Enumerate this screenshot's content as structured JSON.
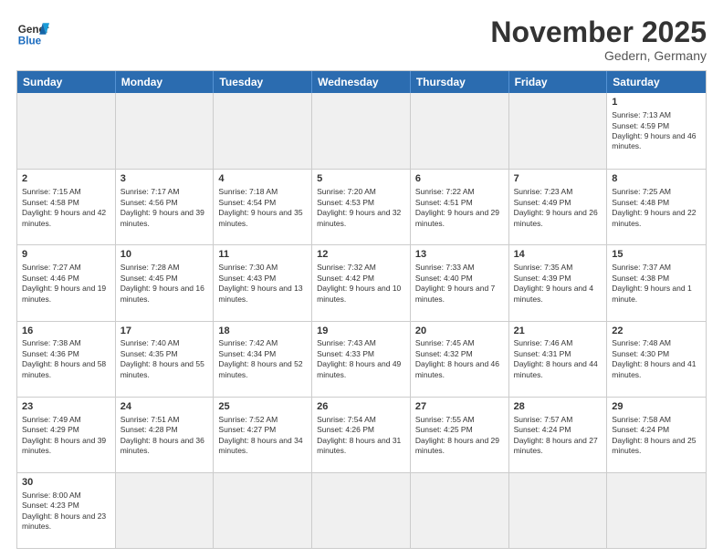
{
  "header": {
    "logo_general": "General",
    "logo_blue": "Blue",
    "month_title": "November 2025",
    "location": "Gedern, Germany"
  },
  "days": [
    "Sunday",
    "Monday",
    "Tuesday",
    "Wednesday",
    "Thursday",
    "Friday",
    "Saturday"
  ],
  "weeks": [
    [
      {
        "num": "",
        "text": "",
        "empty": true
      },
      {
        "num": "",
        "text": "",
        "empty": true
      },
      {
        "num": "",
        "text": "",
        "empty": true
      },
      {
        "num": "",
        "text": "",
        "empty": true
      },
      {
        "num": "",
        "text": "",
        "empty": true
      },
      {
        "num": "",
        "text": "",
        "empty": true
      },
      {
        "num": "1",
        "text": "Sunrise: 7:13 AM\nSunset: 4:59 PM\nDaylight: 9 hours and 46 minutes."
      }
    ],
    [
      {
        "num": "2",
        "text": "Sunrise: 7:15 AM\nSunset: 4:58 PM\nDaylight: 9 hours and 42 minutes."
      },
      {
        "num": "3",
        "text": "Sunrise: 7:17 AM\nSunset: 4:56 PM\nDaylight: 9 hours and 39 minutes."
      },
      {
        "num": "4",
        "text": "Sunrise: 7:18 AM\nSunset: 4:54 PM\nDaylight: 9 hours and 35 minutes."
      },
      {
        "num": "5",
        "text": "Sunrise: 7:20 AM\nSunset: 4:53 PM\nDaylight: 9 hours and 32 minutes."
      },
      {
        "num": "6",
        "text": "Sunrise: 7:22 AM\nSunset: 4:51 PM\nDaylight: 9 hours and 29 minutes."
      },
      {
        "num": "7",
        "text": "Sunrise: 7:23 AM\nSunset: 4:49 PM\nDaylight: 9 hours and 26 minutes."
      },
      {
        "num": "8",
        "text": "Sunrise: 7:25 AM\nSunset: 4:48 PM\nDaylight: 9 hours and 22 minutes."
      }
    ],
    [
      {
        "num": "9",
        "text": "Sunrise: 7:27 AM\nSunset: 4:46 PM\nDaylight: 9 hours and 19 minutes."
      },
      {
        "num": "10",
        "text": "Sunrise: 7:28 AM\nSunset: 4:45 PM\nDaylight: 9 hours and 16 minutes."
      },
      {
        "num": "11",
        "text": "Sunrise: 7:30 AM\nSunset: 4:43 PM\nDaylight: 9 hours and 13 minutes."
      },
      {
        "num": "12",
        "text": "Sunrise: 7:32 AM\nSunset: 4:42 PM\nDaylight: 9 hours and 10 minutes."
      },
      {
        "num": "13",
        "text": "Sunrise: 7:33 AM\nSunset: 4:40 PM\nDaylight: 9 hours and 7 minutes."
      },
      {
        "num": "14",
        "text": "Sunrise: 7:35 AM\nSunset: 4:39 PM\nDaylight: 9 hours and 4 minutes."
      },
      {
        "num": "15",
        "text": "Sunrise: 7:37 AM\nSunset: 4:38 PM\nDaylight: 9 hours and 1 minute."
      }
    ],
    [
      {
        "num": "16",
        "text": "Sunrise: 7:38 AM\nSunset: 4:36 PM\nDaylight: 8 hours and 58 minutes."
      },
      {
        "num": "17",
        "text": "Sunrise: 7:40 AM\nSunset: 4:35 PM\nDaylight: 8 hours and 55 minutes."
      },
      {
        "num": "18",
        "text": "Sunrise: 7:42 AM\nSunset: 4:34 PM\nDaylight: 8 hours and 52 minutes."
      },
      {
        "num": "19",
        "text": "Sunrise: 7:43 AM\nSunset: 4:33 PM\nDaylight: 8 hours and 49 minutes."
      },
      {
        "num": "20",
        "text": "Sunrise: 7:45 AM\nSunset: 4:32 PM\nDaylight: 8 hours and 46 minutes."
      },
      {
        "num": "21",
        "text": "Sunrise: 7:46 AM\nSunset: 4:31 PM\nDaylight: 8 hours and 44 minutes."
      },
      {
        "num": "22",
        "text": "Sunrise: 7:48 AM\nSunset: 4:30 PM\nDaylight: 8 hours and 41 minutes."
      }
    ],
    [
      {
        "num": "23",
        "text": "Sunrise: 7:49 AM\nSunset: 4:29 PM\nDaylight: 8 hours and 39 minutes."
      },
      {
        "num": "24",
        "text": "Sunrise: 7:51 AM\nSunset: 4:28 PM\nDaylight: 8 hours and 36 minutes."
      },
      {
        "num": "25",
        "text": "Sunrise: 7:52 AM\nSunset: 4:27 PM\nDaylight: 8 hours and 34 minutes."
      },
      {
        "num": "26",
        "text": "Sunrise: 7:54 AM\nSunset: 4:26 PM\nDaylight: 8 hours and 31 minutes."
      },
      {
        "num": "27",
        "text": "Sunrise: 7:55 AM\nSunset: 4:25 PM\nDaylight: 8 hours and 29 minutes."
      },
      {
        "num": "28",
        "text": "Sunrise: 7:57 AM\nSunset: 4:24 PM\nDaylight: 8 hours and 27 minutes."
      },
      {
        "num": "29",
        "text": "Sunrise: 7:58 AM\nSunset: 4:24 PM\nDaylight: 8 hours and 25 minutes."
      }
    ],
    [
      {
        "num": "30",
        "text": "Sunrise: 8:00 AM\nSunset: 4:23 PM\nDaylight: 8 hours and 23 minutes."
      },
      {
        "num": "",
        "text": "",
        "empty": true
      },
      {
        "num": "",
        "text": "",
        "empty": true
      },
      {
        "num": "",
        "text": "",
        "empty": true
      },
      {
        "num": "",
        "text": "",
        "empty": true
      },
      {
        "num": "",
        "text": "",
        "empty": true
      },
      {
        "num": "",
        "text": "",
        "empty": true
      }
    ]
  ]
}
